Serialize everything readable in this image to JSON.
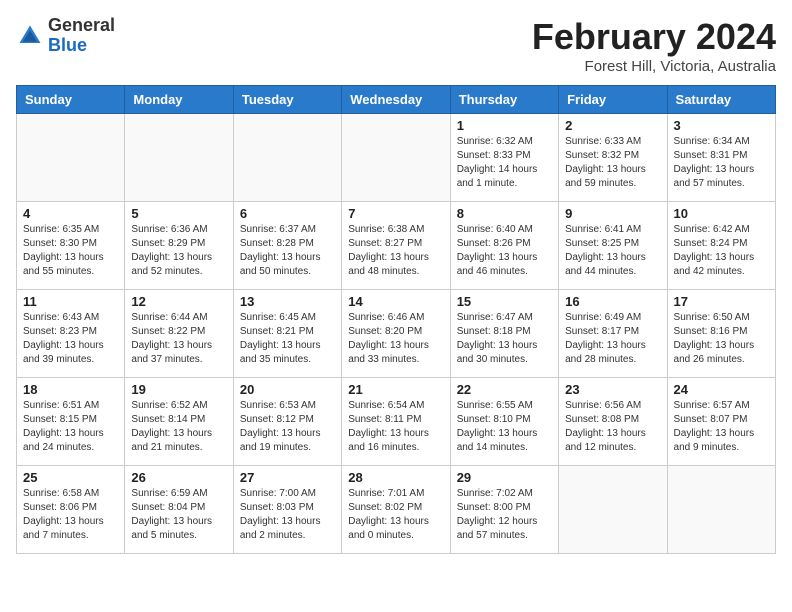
{
  "header": {
    "logo_line1": "General",
    "logo_line2": "Blue",
    "month_title": "February 2024",
    "location": "Forest Hill, Victoria, Australia"
  },
  "weekdays": [
    "Sunday",
    "Monday",
    "Tuesday",
    "Wednesday",
    "Thursday",
    "Friday",
    "Saturday"
  ],
  "weeks": [
    [
      {
        "day": "",
        "info": ""
      },
      {
        "day": "",
        "info": ""
      },
      {
        "day": "",
        "info": ""
      },
      {
        "day": "",
        "info": ""
      },
      {
        "day": "1",
        "info": "Sunrise: 6:32 AM\nSunset: 8:33 PM\nDaylight: 14 hours\nand 1 minute."
      },
      {
        "day": "2",
        "info": "Sunrise: 6:33 AM\nSunset: 8:32 PM\nDaylight: 13 hours\nand 59 minutes."
      },
      {
        "day": "3",
        "info": "Sunrise: 6:34 AM\nSunset: 8:31 PM\nDaylight: 13 hours\nand 57 minutes."
      }
    ],
    [
      {
        "day": "4",
        "info": "Sunrise: 6:35 AM\nSunset: 8:30 PM\nDaylight: 13 hours\nand 55 minutes."
      },
      {
        "day": "5",
        "info": "Sunrise: 6:36 AM\nSunset: 8:29 PM\nDaylight: 13 hours\nand 52 minutes."
      },
      {
        "day": "6",
        "info": "Sunrise: 6:37 AM\nSunset: 8:28 PM\nDaylight: 13 hours\nand 50 minutes."
      },
      {
        "day": "7",
        "info": "Sunrise: 6:38 AM\nSunset: 8:27 PM\nDaylight: 13 hours\nand 48 minutes."
      },
      {
        "day": "8",
        "info": "Sunrise: 6:40 AM\nSunset: 8:26 PM\nDaylight: 13 hours\nand 46 minutes."
      },
      {
        "day": "9",
        "info": "Sunrise: 6:41 AM\nSunset: 8:25 PM\nDaylight: 13 hours\nand 44 minutes."
      },
      {
        "day": "10",
        "info": "Sunrise: 6:42 AM\nSunset: 8:24 PM\nDaylight: 13 hours\nand 42 minutes."
      }
    ],
    [
      {
        "day": "11",
        "info": "Sunrise: 6:43 AM\nSunset: 8:23 PM\nDaylight: 13 hours\nand 39 minutes."
      },
      {
        "day": "12",
        "info": "Sunrise: 6:44 AM\nSunset: 8:22 PM\nDaylight: 13 hours\nand 37 minutes."
      },
      {
        "day": "13",
        "info": "Sunrise: 6:45 AM\nSunset: 8:21 PM\nDaylight: 13 hours\nand 35 minutes."
      },
      {
        "day": "14",
        "info": "Sunrise: 6:46 AM\nSunset: 8:20 PM\nDaylight: 13 hours\nand 33 minutes."
      },
      {
        "day": "15",
        "info": "Sunrise: 6:47 AM\nSunset: 8:18 PM\nDaylight: 13 hours\nand 30 minutes."
      },
      {
        "day": "16",
        "info": "Sunrise: 6:49 AM\nSunset: 8:17 PM\nDaylight: 13 hours\nand 28 minutes."
      },
      {
        "day": "17",
        "info": "Sunrise: 6:50 AM\nSunset: 8:16 PM\nDaylight: 13 hours\nand 26 minutes."
      }
    ],
    [
      {
        "day": "18",
        "info": "Sunrise: 6:51 AM\nSunset: 8:15 PM\nDaylight: 13 hours\nand 24 minutes."
      },
      {
        "day": "19",
        "info": "Sunrise: 6:52 AM\nSunset: 8:14 PM\nDaylight: 13 hours\nand 21 minutes."
      },
      {
        "day": "20",
        "info": "Sunrise: 6:53 AM\nSunset: 8:12 PM\nDaylight: 13 hours\nand 19 minutes."
      },
      {
        "day": "21",
        "info": "Sunrise: 6:54 AM\nSunset: 8:11 PM\nDaylight: 13 hours\nand 16 minutes."
      },
      {
        "day": "22",
        "info": "Sunrise: 6:55 AM\nSunset: 8:10 PM\nDaylight: 13 hours\nand 14 minutes."
      },
      {
        "day": "23",
        "info": "Sunrise: 6:56 AM\nSunset: 8:08 PM\nDaylight: 13 hours\nand 12 minutes."
      },
      {
        "day": "24",
        "info": "Sunrise: 6:57 AM\nSunset: 8:07 PM\nDaylight: 13 hours\nand 9 minutes."
      }
    ],
    [
      {
        "day": "25",
        "info": "Sunrise: 6:58 AM\nSunset: 8:06 PM\nDaylight: 13 hours\nand 7 minutes."
      },
      {
        "day": "26",
        "info": "Sunrise: 6:59 AM\nSunset: 8:04 PM\nDaylight: 13 hours\nand 5 minutes."
      },
      {
        "day": "27",
        "info": "Sunrise: 7:00 AM\nSunset: 8:03 PM\nDaylight: 13 hours\nand 2 minutes."
      },
      {
        "day": "28",
        "info": "Sunrise: 7:01 AM\nSunset: 8:02 PM\nDaylight: 13 hours\nand 0 minutes."
      },
      {
        "day": "29",
        "info": "Sunrise: 7:02 AM\nSunset: 8:00 PM\nDaylight: 12 hours\nand 57 minutes."
      },
      {
        "day": "",
        "info": ""
      },
      {
        "day": "",
        "info": ""
      }
    ]
  ]
}
